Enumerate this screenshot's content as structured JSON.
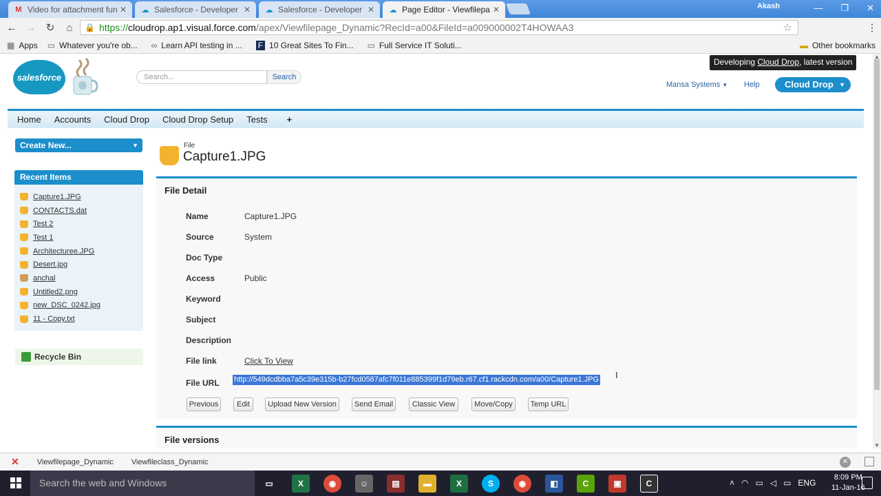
{
  "browser": {
    "tabs": [
      {
        "title": "Video for attachment func",
        "icon": "gmail-icon",
        "active": false
      },
      {
        "title": "Salesforce - Developer Edi",
        "icon": "salesforce-icon",
        "active": false
      },
      {
        "title": "Salesforce - Developer Edi",
        "icon": "salesforce-icon",
        "active": false
      },
      {
        "title": "Page Editor - Viewfilepage",
        "icon": "salesforce-icon",
        "active": true
      }
    ],
    "profile_name": "Akash",
    "url": {
      "scheme": "https://",
      "domain": "cloudrop.ap1.visual.force.com",
      "path": "/apex/Viewfilepage_Dynamic?RecId=a00&FileId=a009000002T4HOWAA3"
    },
    "bookmarks": [
      {
        "label": "Apps",
        "icon": "apps-grid-icon"
      },
      {
        "label": "Whatever you're ob...",
        "icon": "page-icon"
      },
      {
        "label": "Learn API testing in ...",
        "icon": "link-icon"
      },
      {
        "label": "10 Great Sites To Fin...",
        "icon": "f-icon"
      },
      {
        "label": "Full Service IT Soluti...",
        "icon": "page-icon"
      }
    ],
    "other_bookmarks": "Other bookmarks"
  },
  "header": {
    "logo_text": "salesforce",
    "search_placeholder": "Search...",
    "search_button": "Search",
    "dev_badge_prefix": "Developing ",
    "dev_badge_app": "Cloud Drop",
    "dev_badge_suffix": ", latest version",
    "user_menu": "Mansa Systems",
    "help": "Help",
    "app_switcher": "Cloud Drop"
  },
  "nav": {
    "tabs": [
      "Home",
      "Accounts",
      "Cloud Drop",
      "Cloud Drop Setup",
      "Tests"
    ],
    "plus": "+"
  },
  "sidebar": {
    "create_new": "Create New...",
    "recent_header": "Recent Items",
    "recent_items": [
      {
        "label": "Capture1.JPG",
        "icon": "folder-icon"
      },
      {
        "label": "CONTACTS.dat",
        "icon": "folder-icon"
      },
      {
        "label": "Test 2",
        "icon": "folder-icon"
      },
      {
        "label": "Test 1",
        "icon": "folder-icon"
      },
      {
        "label": "Architecturee.JPG",
        "icon": "folder-icon"
      },
      {
        "label": "Desert.jpg",
        "icon": "folder-icon"
      },
      {
        "label": "anchal",
        "icon": "account-icon"
      },
      {
        "label": "Untitled2.png",
        "icon": "folder-icon"
      },
      {
        "label": "new_DSC_0242.jpg",
        "icon": "folder-icon"
      },
      {
        "label": "11 - Copy.txt",
        "icon": "folder-icon"
      }
    ],
    "recycle_bin": "Recycle Bin"
  },
  "record": {
    "type": "File",
    "name": "Capture1.JPG",
    "section_title": "File Detail",
    "fields": [
      {
        "label": "Name",
        "value": "Capture1.JPG"
      },
      {
        "label": "Source",
        "value": "System"
      },
      {
        "label": "Doc Type",
        "value": ""
      },
      {
        "label": "Access",
        "value": "Public"
      },
      {
        "label": "Keyword",
        "value": ""
      },
      {
        "label": "Subject",
        "value": ""
      },
      {
        "label": "Description",
        "value": ""
      },
      {
        "label": "File link",
        "value": "Click To View"
      }
    ],
    "file_url_label": "File URL",
    "file_url": "http://549dcdbba7a5c39e315b-b27fcd0587afc7f011e885399f1d79eb.r67.cf1.rackcdn.com/a00/Capture1.JPG",
    "buttons": [
      "Previous",
      "Edit",
      "Upload New Version",
      "Send Email",
      "Classic View",
      "Move/Copy",
      "Temp URL"
    ],
    "versions_title": "File versions"
  },
  "dev_footer": {
    "pages": [
      "Viewfilepage_Dynamic",
      "Viewfileclass_Dynamic"
    ]
  },
  "taskbar": {
    "search_placeholder": "Search the web and Windows",
    "language": "ENG",
    "time": "8:09 PM",
    "date": "11-Jan-16"
  }
}
